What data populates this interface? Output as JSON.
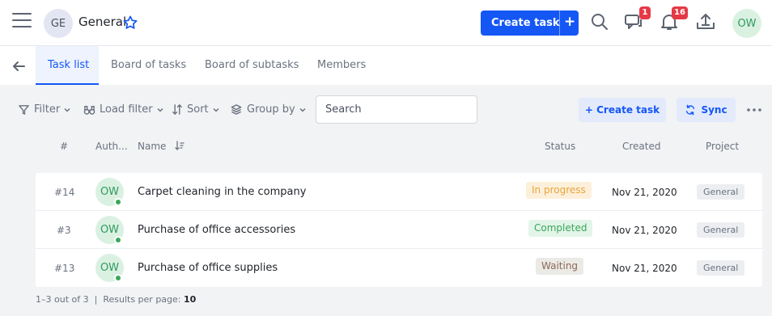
{
  "header": {
    "project_initials": "GE",
    "project_title": "General",
    "create_task_label": "Create task",
    "create_task_plus": "+",
    "messages_badge": "1",
    "notifications_badge": "16",
    "user_initials": "OW"
  },
  "tabs": [
    {
      "label": "Task list",
      "active": true
    },
    {
      "label": "Board of tasks",
      "active": false
    },
    {
      "label": "Board of subtasks",
      "active": false
    },
    {
      "label": "Members",
      "active": false
    }
  ],
  "toolbar": {
    "filter_label": "Filter",
    "load_filter_label": "Load filter",
    "sort_label": "Sort",
    "group_by_label": "Group by",
    "search_placeholder": "Search",
    "create_task_label": "+ Create task",
    "sync_label": "Sync"
  },
  "table": {
    "columns": [
      "#",
      "Auth...",
      "Name",
      "Status",
      "Created",
      "Project"
    ],
    "rows": [
      {
        "num": "#14",
        "author": "OW",
        "name": "Carpet cleaning in the company",
        "status": "In progress",
        "created": "Nov 21, 2020",
        "project": "General"
      },
      {
        "num": "#3",
        "author": "OW",
        "name": "Purchase of office accessories",
        "status": "Completed",
        "created": "Nov 21, 2020",
        "project": "General"
      },
      {
        "num": "#13",
        "author": "OW",
        "name": "Purchase of office supplies",
        "status": "Waiting",
        "created": "Nov 21, 2020",
        "project": "General"
      }
    ]
  },
  "footer": {
    "range": "1–3 out of 3",
    "separator": "|",
    "per_page_label": "Results per page:",
    "per_page_value": "10"
  },
  "colors": {
    "accent": "#1457f5",
    "in_progress_bg": "#fdf0da",
    "in_progress_fg": "#e8a43c",
    "completed_bg": "#e3f5e8",
    "completed_fg": "#3aa65a",
    "waiting_bg": "#eceae6",
    "waiting_fg": "#8a6a58"
  }
}
